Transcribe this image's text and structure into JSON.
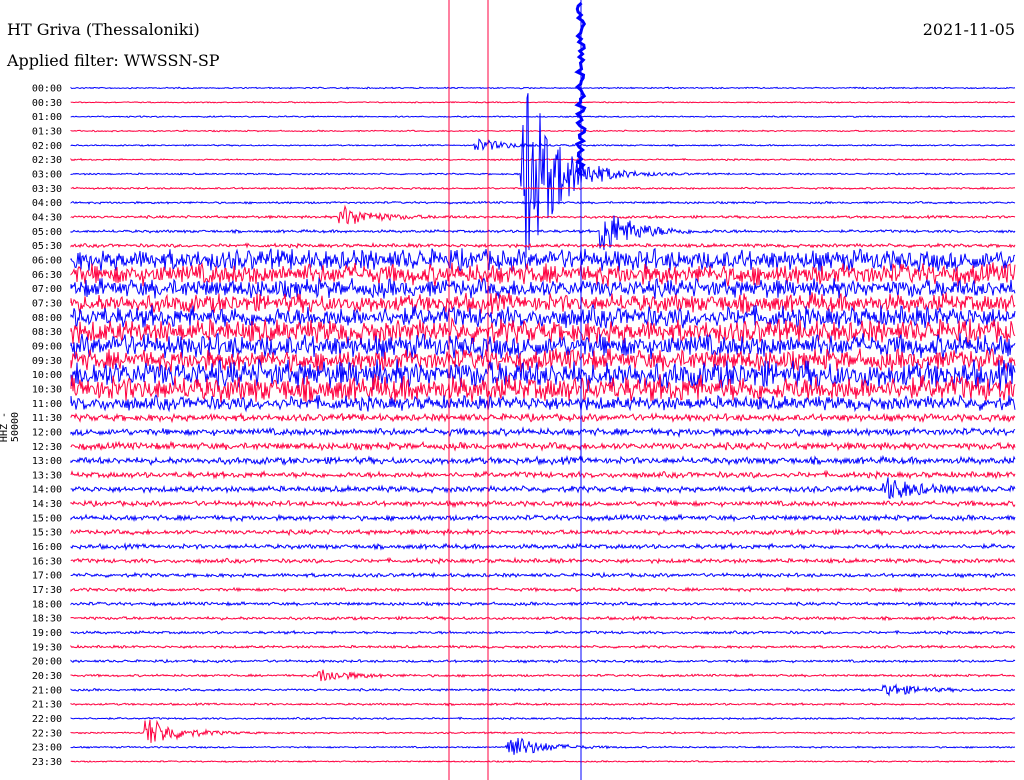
{
  "header": {
    "station": "HT Griva (Thessaloniki)",
    "date": "2021-11-05",
    "filter": "Applied filter: WWSSN-SP"
  },
  "axis": {
    "ylabel": "HHZ - 50000"
  },
  "colors": {
    "trace_a": "#0000ff",
    "trace_b": "#ff0040",
    "marker": "#ff0040",
    "background": "#ffffff"
  },
  "chart_data": {
    "type": "line",
    "title": "HT Griva (Thessaloniki)",
    "subtitle": "Applied filter: WWSSN-SP",
    "date": "2021-11-05",
    "ylabel": "HHZ - 50000",
    "row_interval_minutes": 30,
    "row_labels": [
      "00:00",
      "00:30",
      "01:00",
      "01:30",
      "02:00",
      "02:30",
      "03:00",
      "03:30",
      "04:00",
      "04:30",
      "05:00",
      "05:30",
      "06:00",
      "06:30",
      "07:00",
      "07:30",
      "08:00",
      "08:30",
      "09:00",
      "09:30",
      "10:00",
      "10:30",
      "11:00",
      "11:30",
      "12:00",
      "12:30",
      "13:00",
      "13:30",
      "14:00",
      "14:30",
      "15:00",
      "15:30",
      "16:00",
      "16:30",
      "17:00",
      "17:30",
      "18:00",
      "18:30",
      "19:00",
      "19:30",
      "20:00",
      "20:30",
      "21:00",
      "21:30",
      "22:00",
      "22:30",
      "23:00",
      "23:30"
    ],
    "noise_level": [
      0.6,
      0.5,
      0.6,
      0.6,
      0.6,
      0.7,
      0.7,
      0.8,
      0.9,
      1.1,
      1.2,
      1.5,
      9,
      9,
      8,
      8,
      9,
      10,
      10,
      9,
      12,
      11,
      6,
      3,
      3,
      3,
      3,
      2.5,
      2.5,
      2.2,
      2.2,
      2,
      2,
      1.8,
      1.6,
      1.4,
      1.4,
      1.3,
      1.2,
      1.1,
      1.1,
      1.0,
      1.0,
      0.9,
      0.8,
      0.7,
      0.7,
      0.6
    ],
    "events": [
      {
        "row": 4,
        "minute": 13,
        "amplitude": 6
      },
      {
        "row": 6,
        "minute": 14.5,
        "amplitude": 95
      },
      {
        "row": 9,
        "minute": 8.7,
        "amplitude": 10
      },
      {
        "row": 10,
        "minute": 17,
        "amplitude": 22
      },
      {
        "row": 28,
        "minute": 26,
        "amplitude": 10
      },
      {
        "row": 41,
        "minute": 8,
        "amplitude": 6
      },
      {
        "row": 42,
        "minute": 26,
        "amplitude": 6
      },
      {
        "row": 45,
        "minute": 2.5,
        "amplitude": 14
      },
      {
        "row": 46,
        "minute": 14,
        "amplitude": 12
      }
    ],
    "grid": false
  }
}
